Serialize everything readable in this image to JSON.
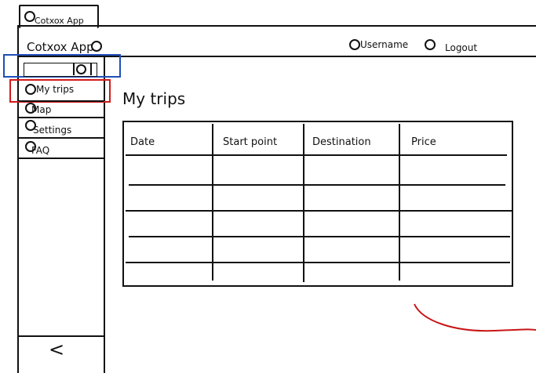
{
  "window_tab": {
    "label": "Cotxox App"
  },
  "header": {
    "app_title": "Cotxox App",
    "username_label": "Username",
    "logout_label": "Logout"
  },
  "sidebar": {
    "items": [
      {
        "label": "My trips"
      },
      {
        "label": "Map"
      },
      {
        "label": "Settings"
      },
      {
        "label": "FAQ"
      }
    ],
    "collapse_glyph": "<"
  },
  "main": {
    "title": "My trips",
    "table": {
      "columns": [
        "Date",
        "Start point",
        "Destination",
        "Price"
      ],
      "rows": [
        [
          "",
          "",
          "",
          ""
        ],
        [
          "",
          "",
          "",
          ""
        ],
        [
          "",
          "",
          "",
          ""
        ],
        [
          "",
          "",
          "",
          ""
        ],
        [
          "",
          "",
          "",
          ""
        ]
      ]
    }
  },
  "colors": {
    "highlight_blue": "#1f4fb8",
    "highlight_red": "#d11a1a",
    "annotation_red": "#c81616"
  }
}
